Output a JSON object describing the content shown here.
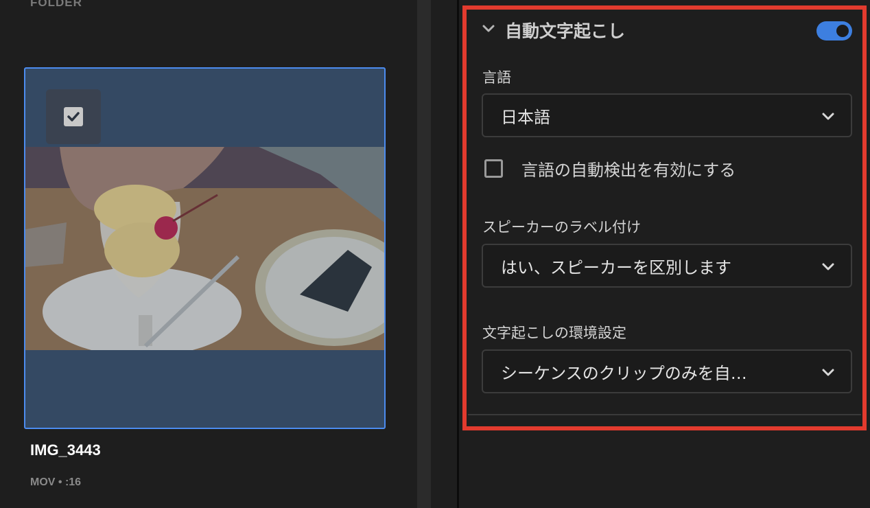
{
  "left": {
    "folder_label": "FOLDER",
    "clip": {
      "name": "IMG_3443",
      "meta": "MOV • :16",
      "checked": true
    }
  },
  "panel": {
    "title": "自動文字起こし",
    "enabled": true,
    "language": {
      "label": "言語",
      "value": "日本語"
    },
    "auto_detect": {
      "label": "言語の自動検出を有効にする",
      "checked": false
    },
    "speaker": {
      "label": "スピーカーのラベル付け",
      "value": "はい、スピーカーを区別します"
    },
    "preference": {
      "label": "文字起こしの環境設定",
      "value": "シーケンスのクリップのみを自…"
    }
  },
  "colors": {
    "accent": "#3d7fe0",
    "highlight": "#e23b2e",
    "selection": "#344963"
  }
}
